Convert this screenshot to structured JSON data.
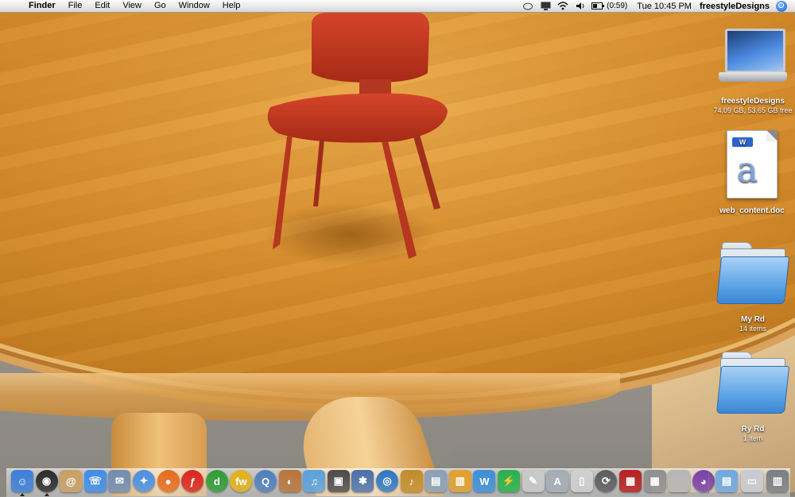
{
  "menubar": {
    "app_name": "Finder",
    "menus": [
      "File",
      "Edit",
      "View",
      "Go",
      "Window",
      "Help"
    ],
    "battery_time": "(0:59)",
    "clock": "Tue 10:45 PM",
    "username": "freestyleDesigns",
    "status_icons": [
      "chat-icon",
      "display-icon",
      "wifi-icon",
      "volume-icon",
      "battery-icon"
    ]
  },
  "desktop": {
    "drive": {
      "name": "freestyleDesigns",
      "info": "74.09 GB, 53.65 GB free"
    },
    "document": {
      "name": "web_content.doc",
      "badge": "W",
      "glyph": "a"
    },
    "folders": [
      {
        "name": "My Rd",
        "info": "14 items"
      },
      {
        "name": "Ry Rd",
        "info": "1 item"
      }
    ]
  },
  "dock": {
    "apps": [
      {
        "icon": "finder-icon",
        "color": "#3b7fd9",
        "glyph": "☺",
        "running": true
      },
      {
        "icon": "dashboard-icon",
        "color": "#2b2b2b",
        "glyph": "◉",
        "running": true
      },
      {
        "icon": "address-book-icon",
        "color": "#c9a064",
        "glyph": "@"
      },
      {
        "icon": "ichat-icon",
        "color": "#3f8ee6",
        "glyph": "☏"
      },
      {
        "icon": "mail-icon",
        "color": "#6f8db3",
        "glyph": "✉"
      },
      {
        "icon": "safari-icon",
        "color": "#4a90e2",
        "glyph": "✦"
      },
      {
        "icon": "firefox-icon",
        "color": "#e66a1f",
        "glyph": "●"
      },
      {
        "icon": "flash-icon",
        "color": "#d8261e",
        "glyph": "ƒ"
      },
      {
        "icon": "dreamweaver-icon",
        "color": "#2e9e34",
        "glyph": "d"
      },
      {
        "icon": "fireworks-icon",
        "color": "#e3b21a",
        "glyph": "fw"
      },
      {
        "icon": "quicktime-icon",
        "color": "#4f7fbf",
        "glyph": "Q"
      },
      {
        "icon": "photo-icon",
        "color": "#b8743a",
        "glyph": "◐"
      },
      {
        "icon": "itunes-icon",
        "color": "#5aa0dc",
        "glyph": "♫"
      },
      {
        "icon": "iphoto-icon",
        "color": "#4b4b4b",
        "glyph": "▣"
      },
      {
        "icon": "imovie-icon",
        "color": "#4b6fa8",
        "glyph": "✱"
      },
      {
        "icon": "idvd-icon",
        "color": "#2f76c2",
        "glyph": "◎"
      },
      {
        "icon": "garageband-icon",
        "color": "#c28a2a",
        "glyph": "♪"
      },
      {
        "icon": "preview-icon",
        "color": "#8aa0b8",
        "glyph": "▤"
      },
      {
        "icon": "pages-icon",
        "color": "#e2a12b",
        "glyph": "▥"
      },
      {
        "icon": "word-icon",
        "color": "#3c8fd8",
        "glyph": "W"
      },
      {
        "icon": "network-icon",
        "color": "#28b14a",
        "glyph": "⚡"
      },
      {
        "icon": "textedit-icon",
        "color": "#c9c9c9",
        "glyph": "✎"
      },
      {
        "icon": "utility-icon",
        "color": "#a4adb6",
        "glyph": "A"
      },
      {
        "icon": "ipod-icon",
        "color": "#d0d0d0",
        "glyph": "▯"
      },
      {
        "icon": "sync-icon",
        "color": "#5d5d5d",
        "glyph": "⟳"
      },
      {
        "icon": "photobooth-icon",
        "color": "#b81f1f",
        "glyph": "▦"
      },
      {
        "icon": "calculator-icon",
        "color": "#8e8e8e",
        "glyph": "▦"
      },
      {
        "icon": "system-prefs-icon",
        "color": "#b5b5b5",
        "glyph": ""
      },
      {
        "icon": "scrobbler-icon",
        "color": "#7b3fa8",
        "glyph": "◕"
      }
    ],
    "right_items": [
      {
        "icon": "documents-folder-icon",
        "color": "#6ea8e0",
        "glyph": "▤"
      },
      {
        "icon": "downloads-stack-icon",
        "color": "#c8ccd2",
        "glyph": "▭"
      },
      {
        "icon": "trash-icon",
        "color": "#7a7e83",
        "glyph": "▥"
      }
    ]
  }
}
